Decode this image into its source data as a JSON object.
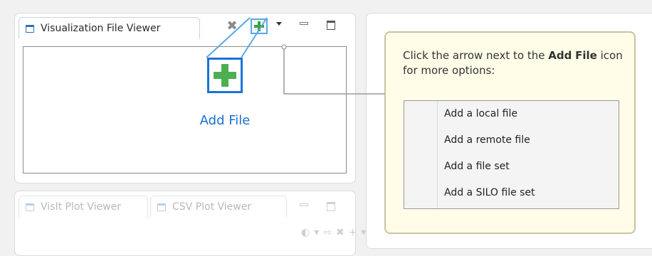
{
  "viewer": {
    "tab_label": "Visualization File Viewer",
    "tab_icon": "window-icon"
  },
  "toolbar": {
    "wrench_icon": "wrench-icon",
    "add_icon": "green-plus-icon",
    "dropdown_icon": "dropdown-arrow-icon",
    "minimize_icon": "minimize-icon",
    "maximize_icon": "maximize-icon"
  },
  "zoom": {
    "label": "Add File"
  },
  "callout": {
    "text_before": "Click the arrow next to the ",
    "text_bold_1": "Add",
    "text_bold_2": "File",
    "text_after": " icon for more options:",
    "menu_items": [
      "Add a local file",
      "Add a remote file",
      "Add a file set",
      "Add a SILO file set"
    ]
  },
  "plot_panel": {
    "tab1_label": "VisIt Plot Viewer",
    "tab2_label": "CSV Plot Viewer"
  },
  "colors": {
    "accent_blue": "#1a73d9",
    "plus_green": "#3aa13a",
    "callout_bg": "#fffde8"
  }
}
